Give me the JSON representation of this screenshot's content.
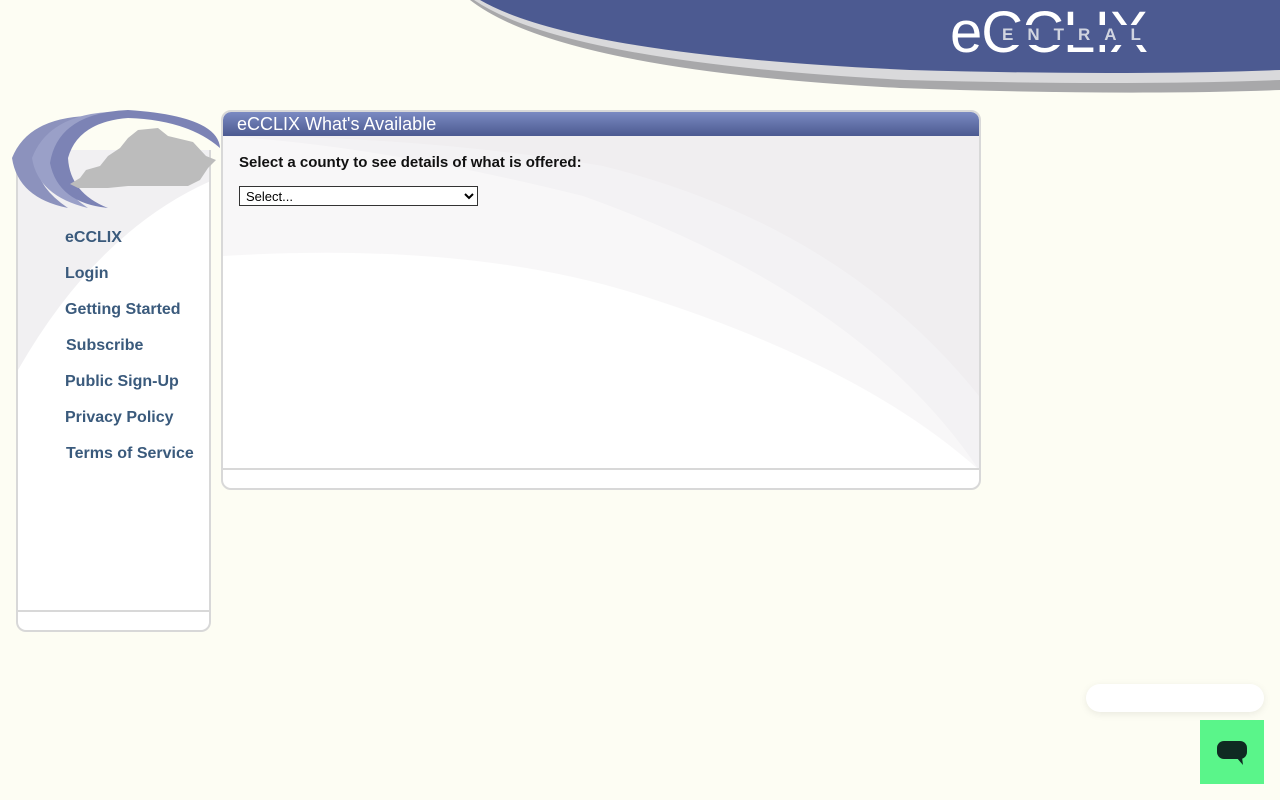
{
  "header": {
    "logo_main": "eCCLIX",
    "logo_sub": "ENTRAL",
    "brand_color": "#4c5a91"
  },
  "sidebar": {
    "emblem": "kentucky-map-icon",
    "items": [
      {
        "label": "eCCLIX"
      },
      {
        "label": "Login"
      },
      {
        "label": "Getting Started"
      },
      {
        "label": "Subscribe"
      },
      {
        "label": "Public Sign-Up"
      },
      {
        "label": "Privacy Policy"
      },
      {
        "label": "Terms of Service"
      }
    ]
  },
  "panel": {
    "title": "eCCLIX What's Available",
    "prompt": "Select a county to see details of what is offered:",
    "county_select": {
      "selected": "Select..."
    }
  },
  "chat": {
    "icon": "chat-icon",
    "button_color": "#5af58a"
  }
}
